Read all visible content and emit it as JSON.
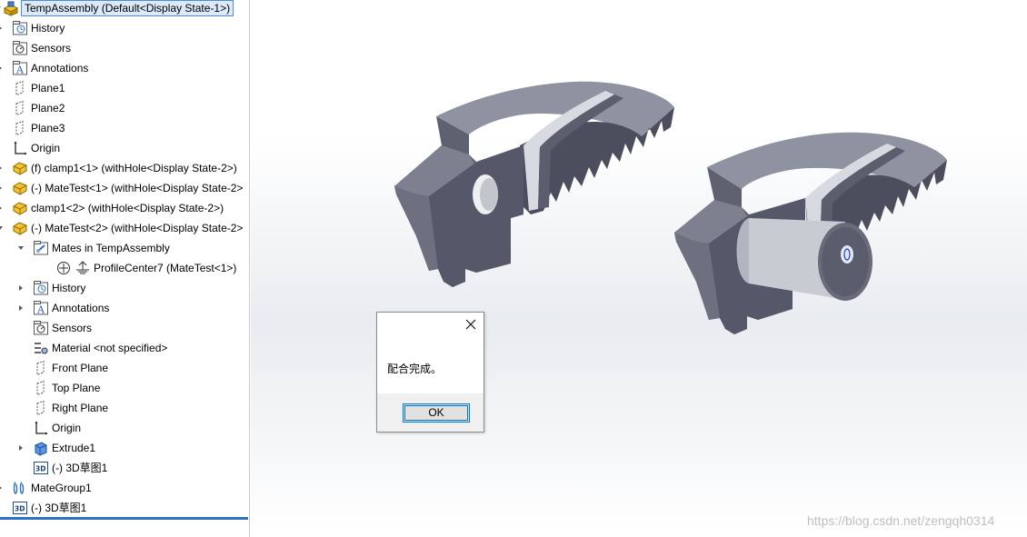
{
  "tree": {
    "root_label": "TempAssembly  (Default<Display State-1>)",
    "items": [
      {
        "label": "History",
        "icon": "history-icon",
        "expander": "right",
        "indent": 0
      },
      {
        "label": "Sensors",
        "icon": "sensors-icon",
        "expander": "none",
        "indent": 0
      },
      {
        "label": "Annotations",
        "icon": "annotations-icon",
        "expander": "right",
        "indent": 0
      },
      {
        "label": "Plane1",
        "icon": "plane-icon",
        "expander": "none",
        "indent": 0
      },
      {
        "label": "Plane2",
        "icon": "plane-icon",
        "expander": "none",
        "indent": 0
      },
      {
        "label": "Plane3",
        "icon": "plane-icon",
        "expander": "none",
        "indent": 0
      },
      {
        "label": "Origin",
        "icon": "origin-icon",
        "expander": "none",
        "indent": 0
      },
      {
        "label": "(f) clamp1<1> (withHole<Display State-2>)",
        "icon": "part-icon",
        "expander": "right",
        "indent": 0
      },
      {
        "label": "(-) MateTest<1> (withHole<Display State-2>",
        "icon": "part-icon",
        "expander": "right",
        "indent": 0
      },
      {
        "label": "clamp1<2> (withHole<Display State-2>)",
        "icon": "part-icon",
        "expander": "right",
        "indent": 0
      },
      {
        "label": "(-) MateTest<2> (withHole<Display State-2>",
        "icon": "part-icon",
        "expander": "down",
        "indent": 0
      },
      {
        "label": "Mates in TempAssembly",
        "icon": "mates-folder-icon",
        "expander": "down",
        "indent": 1
      },
      {
        "label": "ProfileCenter7 (MateTest<1>)",
        "icon": "profile-center-mate-icon",
        "expander": "none",
        "indent": 2
      },
      {
        "label": "History",
        "icon": "history-icon",
        "expander": "right",
        "indent": 1
      },
      {
        "label": "Annotations",
        "icon": "annotations-icon",
        "expander": "right",
        "indent": 1
      },
      {
        "label": "Sensors",
        "icon": "sensors-icon",
        "expander": "none",
        "indent": 1
      },
      {
        "label": "Material <not specified>",
        "icon": "material-icon",
        "expander": "none",
        "indent": 1
      },
      {
        "label": "Front Plane",
        "icon": "plane-icon",
        "expander": "none",
        "indent": 1
      },
      {
        "label": "Top Plane",
        "icon": "plane-icon",
        "expander": "none",
        "indent": 1
      },
      {
        "label": "Right Plane",
        "icon": "plane-icon",
        "expander": "none",
        "indent": 1
      },
      {
        "label": "Origin",
        "icon": "origin-icon",
        "expander": "none",
        "indent": 1
      },
      {
        "label": "Extrude1",
        "icon": "extrude-icon",
        "expander": "right",
        "indent": 1
      },
      {
        "label": "(-) 3D草图1",
        "icon": "sketch-3d-icon",
        "expander": "none",
        "indent": 1
      },
      {
        "label": "MateGroup1",
        "icon": "mategroup-icon",
        "expander": "right",
        "indent": 0
      },
      {
        "label": "(-) 3D草图1",
        "icon": "sketch-3d-icon",
        "expander": "none",
        "indent": 0
      }
    ]
  },
  "dialog": {
    "message": "配合完成。",
    "ok_label": "OK"
  },
  "watermark": "https://blog.csdn.net/zengqh0314",
  "colors": {
    "selection_border": "#4d8fd6",
    "selection_fill": "#dbe9f9",
    "part_gray": "#6e7180",
    "accent_blue": "#2c73c8"
  }
}
